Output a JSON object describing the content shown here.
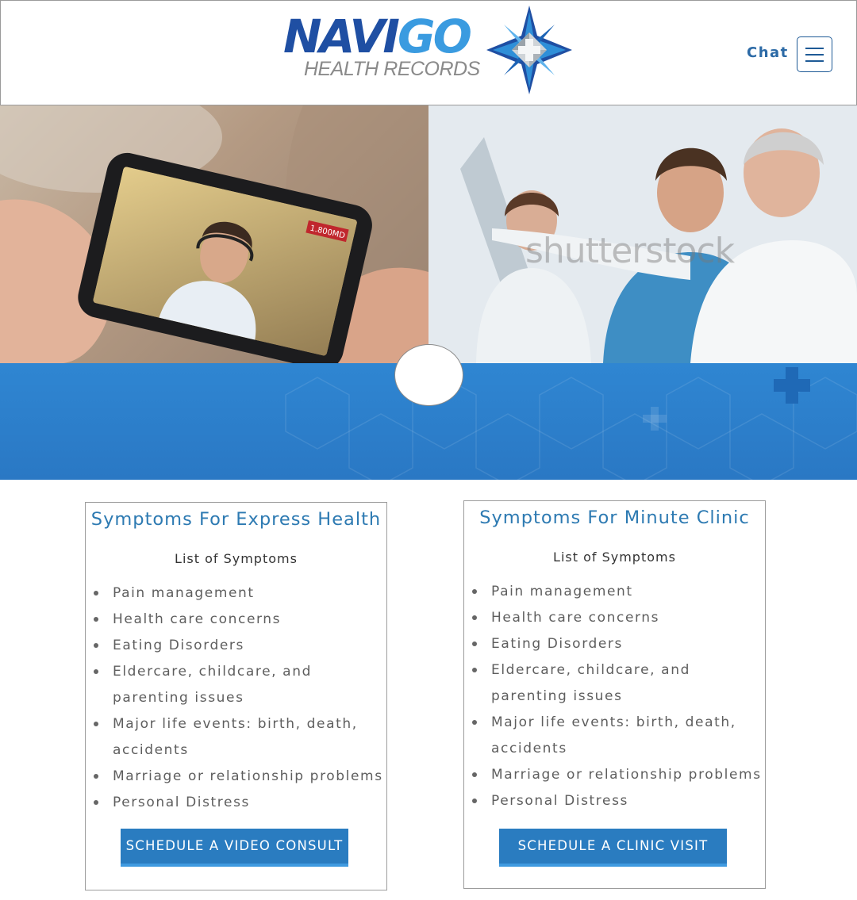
{
  "header": {
    "logo_word_part1": "NAVI",
    "logo_word_part2": "GO",
    "logo_subtitle": "HEALTH RECORDS",
    "chat_label": "Chat",
    "menu_icon": "hamburger-menu-icon"
  },
  "hero": {
    "left_image": "telehealth-video-call-photo",
    "right_image": "doctors-reviewing-xray-photo",
    "watermark": "shutterstock",
    "phone_badge": "1.800MD"
  },
  "cards": [
    {
      "title": "Symptoms For Express Health",
      "subtitle": "List of Symptoms",
      "symptoms": [
        "Pain management",
        "Health care concerns",
        "Eating Disorders",
        "Eldercare, childcare, and parenting issues",
        "Major life events: birth, death, accidents",
        "Marriage or relationship problems",
        "Personal Distress"
      ],
      "button_label": "SCHEDULE A VIDEO CONSULT"
    },
    {
      "title": "Symptoms For Minute Clinic",
      "subtitle": "List of Symptoms",
      "symptoms": [
        "Pain management",
        "Health care concerns",
        "Eating Disorders",
        "Eldercare, childcare, and parenting issues",
        "Major life events: birth, death, accidents",
        "Marriage or relationship problems",
        "Personal Distress"
      ],
      "button_label": "SCHEDULE A CLINIC VISIT"
    }
  ],
  "colors": {
    "brand_dark_blue": "#1f4fa3",
    "brand_light_blue": "#3a9be0",
    "band_blue": "#2f86d2",
    "button_blue": "#2a7cc0",
    "title_blue": "#2d7ab2"
  }
}
